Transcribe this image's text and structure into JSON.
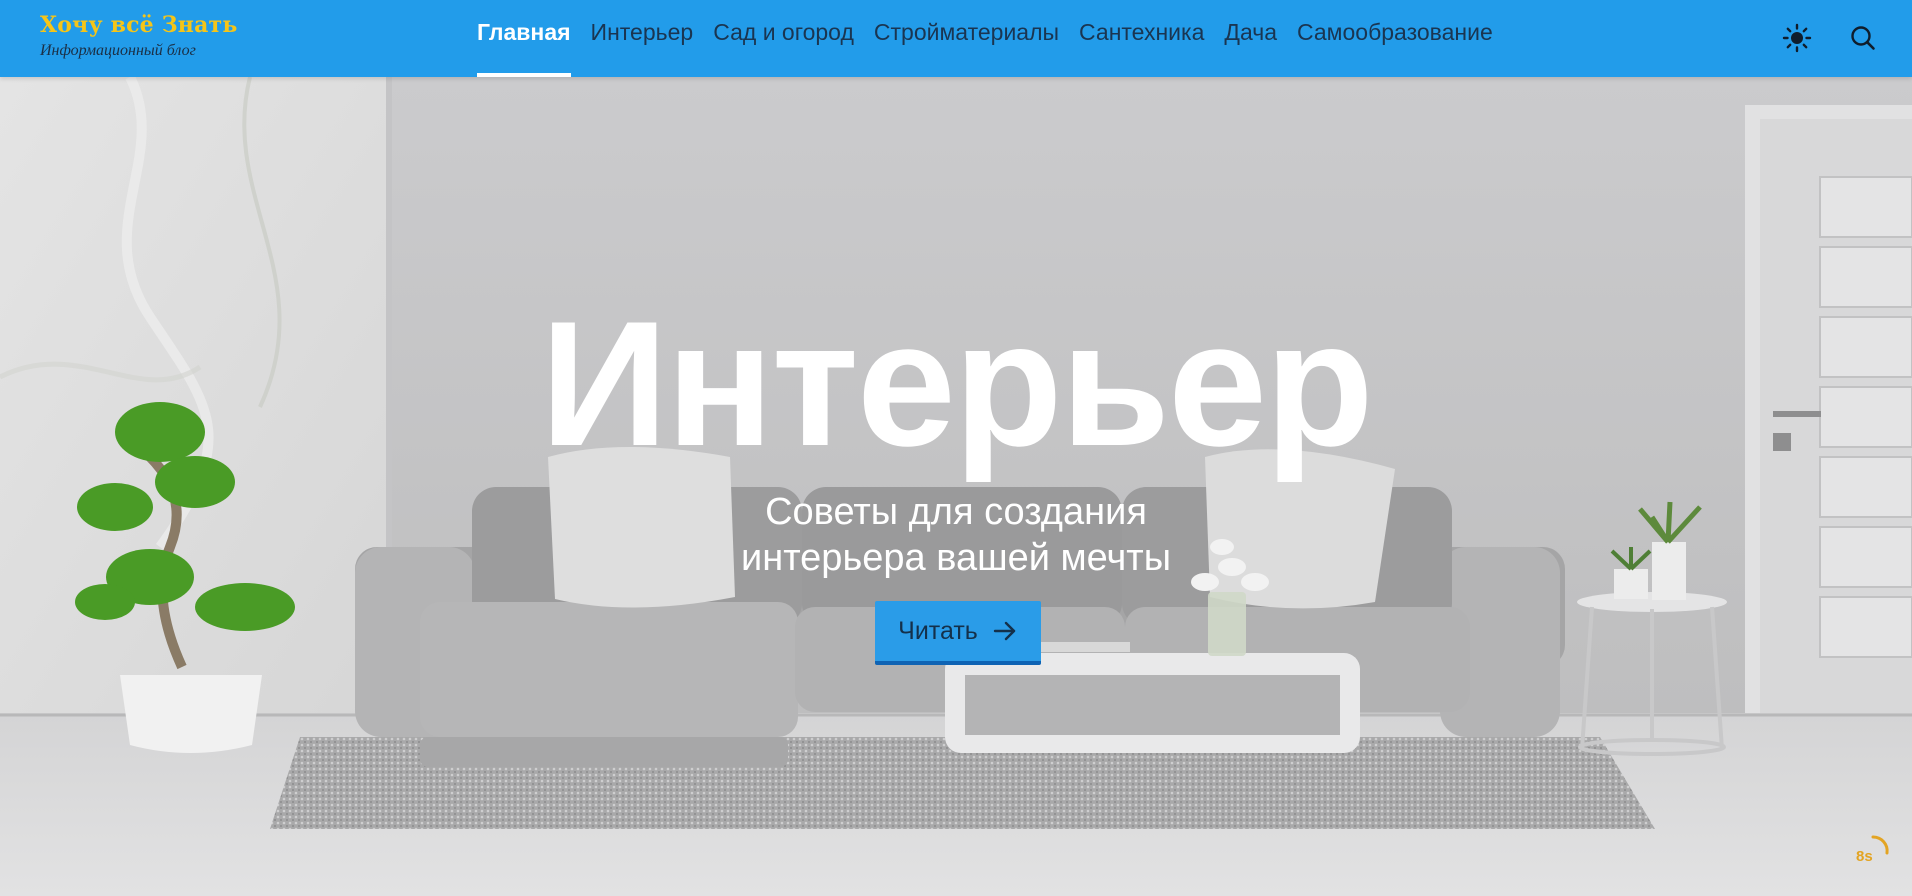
{
  "brand": {
    "title": "Хочу всё Знать",
    "subtitle": "Информационный блог"
  },
  "nav": {
    "items": [
      {
        "label": "Главная",
        "active": true
      },
      {
        "label": "Интерьер"
      },
      {
        "label": "Сад и огород"
      },
      {
        "label": "Стройматериалы"
      },
      {
        "label": "Сантехника"
      },
      {
        "label": "Дача"
      },
      {
        "label": "Самообразование"
      }
    ]
  },
  "header_icons": {
    "theme": "sun-icon",
    "search": "search-icon"
  },
  "hero": {
    "title": "Интерьер",
    "subtitle_line1": "Советы для создания",
    "subtitle_line2": "интерьера вашей мечты",
    "button_label": "Читать",
    "button_icon": "arrow-right-icon"
  },
  "loader": {
    "text": "8s"
  },
  "colors": {
    "header_bg": "#229cea",
    "brand_title": "#f5c518",
    "nav_text": "#1a3551",
    "nav_active": "#ffffff",
    "button_bg": "#2a9ce8",
    "button_border": "#0e63b4",
    "loader_accent": "#e3a423"
  }
}
